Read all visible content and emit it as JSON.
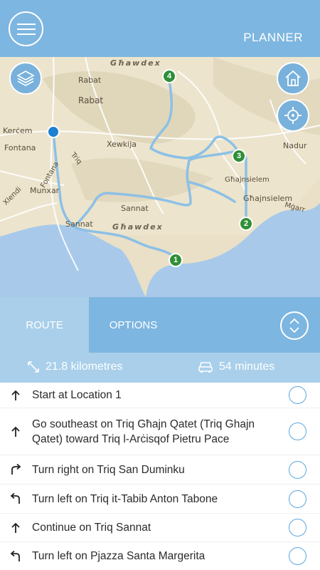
{
  "header": {
    "title": "PLANNER",
    "menu_icon": "hamburger-icon"
  },
  "map": {
    "labels": {
      "ghawdex_top": "Għawdex",
      "ghawdex_bottom": "Għawdex",
      "rabat_road": "Rabat",
      "rabat": "Rabat",
      "kercem": "Kerċem",
      "fontana": "Fontana",
      "xewkija": "Xewkija",
      "munxar": "Munxar",
      "sannat": "Sannat",
      "sannat_road": "Sannat",
      "nadur": "Nadur",
      "ghajnsielem": "Għajnsielem",
      "ghajnsielem_road": "Għajnsielem",
      "xlendi": "Xlendi",
      "mgarr": "Mġarr",
      "triq": "Triq",
      "fontana_road": "Fontana"
    },
    "markers": [
      "1",
      "2",
      "3",
      "4"
    ],
    "buttons": [
      "layers-icon",
      "home-icon",
      "crosshair-icon"
    ]
  },
  "tabs": {
    "route": "ROUTE",
    "options": "OPTIONS"
  },
  "summary": {
    "distance": "21.8 kilometres",
    "duration": "54 minutes"
  },
  "steps": [
    {
      "icon": "arrow-up-icon",
      "text": "Start at Location 1"
    },
    {
      "icon": "arrow-up-icon",
      "text": "Go southeast on Triq Għajn Qatet (Triq Ghajn Qatet) toward Triq l-Arċisqof Pietru Pace"
    },
    {
      "icon": "turn-right-icon",
      "text": "Turn right on Triq San Duminku"
    },
    {
      "icon": "turn-left-icon",
      "text": "Turn left on Triq it-Tabib Anton Tabone"
    },
    {
      "icon": "arrow-up-icon",
      "text": "Continue on Triq Sannat"
    },
    {
      "icon": "turn-left-icon",
      "text": "Turn left on Pjazza Santa Margerita"
    }
  ],
  "colors": {
    "accent": "#7db6e0",
    "accent_light": "#a9cfea",
    "marker": "#2f8f37",
    "route": "#8cc0e6",
    "sea": "#a8c9ea"
  }
}
